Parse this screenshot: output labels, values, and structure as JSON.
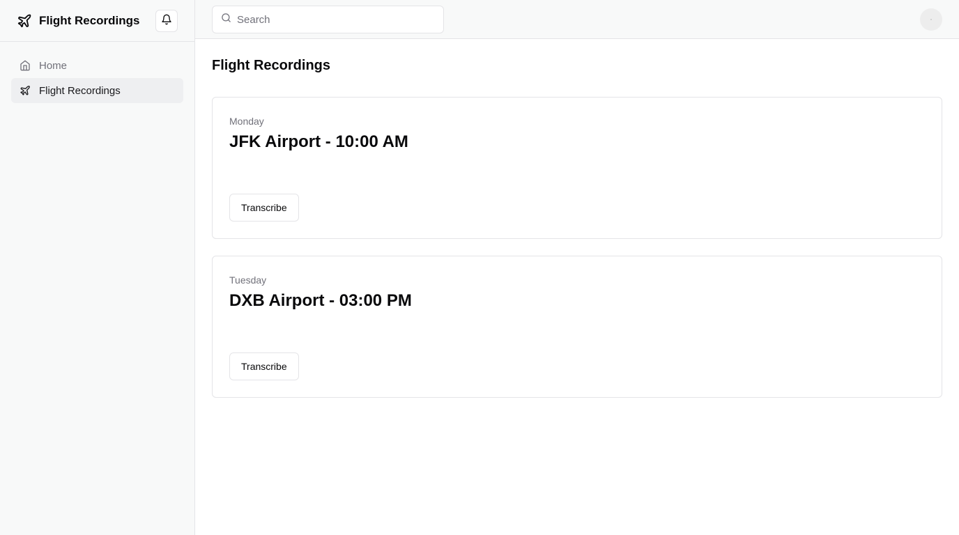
{
  "app": {
    "name": "Flight Recordings",
    "icon": "plane-icon"
  },
  "header": {
    "notification_icon": "bell-icon"
  },
  "sidebar": {
    "items": [
      {
        "label": "Home",
        "icon": "home-icon",
        "active": false
      },
      {
        "label": "Flight Recordings",
        "icon": "plane-icon",
        "active": true
      }
    ]
  },
  "search": {
    "placeholder": "Search",
    "value": "",
    "icon": "search-icon"
  },
  "user": {
    "avatar": "avatar"
  },
  "main": {
    "title": "Flight Recordings",
    "recordings": [
      {
        "day": "Monday",
        "title": "JFK Airport - 10:00 AM",
        "action_label": "Transcribe"
      },
      {
        "day": "Tuesday",
        "title": "DXB Airport - 03:00 PM",
        "action_label": "Transcribe"
      }
    ]
  },
  "colors": {
    "sidebar_bg": "#f8f9f9",
    "active_item_bg": "#eeeff1",
    "border": "#e4e4e7",
    "muted_text": "#71717a",
    "text": "#09090b"
  }
}
